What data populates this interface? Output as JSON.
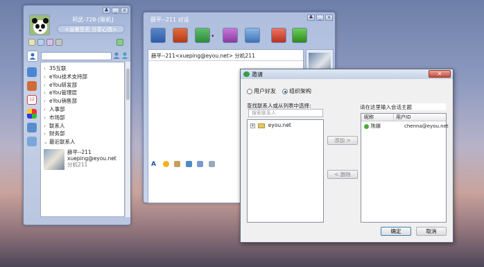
{
  "main_window": {
    "name": "阿武-728-[联机]",
    "signature": "<设置签名 分享心情>",
    "groups": [
      {
        "label": "35互联",
        "expanded": false
      },
      {
        "label": "eYou技术支持部",
        "expanded": false
      },
      {
        "label": "eYou研发部",
        "expanded": false
      },
      {
        "label": "eYou管理层",
        "expanded": false
      },
      {
        "label": "eYou销售部",
        "expanded": false
      },
      {
        "label": "人事部",
        "expanded": false
      },
      {
        "label": "市场部",
        "expanded": false
      },
      {
        "label": "联系人",
        "expanded": false
      },
      {
        "label": "财务部",
        "expanded": false
      },
      {
        "label": "最近联系人",
        "expanded": true
      }
    ],
    "recent_contact": {
      "name": "薛平--211",
      "email": "xueping@eyou.net",
      "extension": "分机211"
    }
  },
  "chat_window": {
    "title": "薛平--211 对话",
    "header": "薛平--211<xueping@eyou.net> 分机211",
    "toolbar_icons": [
      "add-contact-icon",
      "file-transfer-icon",
      "screenshot-icon",
      "audio-icon",
      "video-icon",
      "remote-assist-icon",
      "settings-icon"
    ]
  },
  "invite_dialog": {
    "title": "邀请",
    "close_label": "✕",
    "radio_friends": "用户好友",
    "radio_org": "组织架构",
    "selected_radio": "组织架构",
    "find_label": "查找联系人或从列表中选择:",
    "search_placeholder": "搜索联系人",
    "tree_root": "eyou.net",
    "add_button": "添加 >",
    "remove_button": "< 删除",
    "topic_label": "请在这里输入会话主题",
    "columns": [
      "昵称",
      "用户ID"
    ],
    "members": [
      {
        "nickname": "陈娜",
        "user_id": "chenna@eyou.net"
      }
    ],
    "ok_button": "确定",
    "cancel_button": "取消"
  },
  "colors": {
    "accent": "#1f4fa8",
    "window_frame": "#6d81ab",
    "online_status": "#4cae3a"
  }
}
